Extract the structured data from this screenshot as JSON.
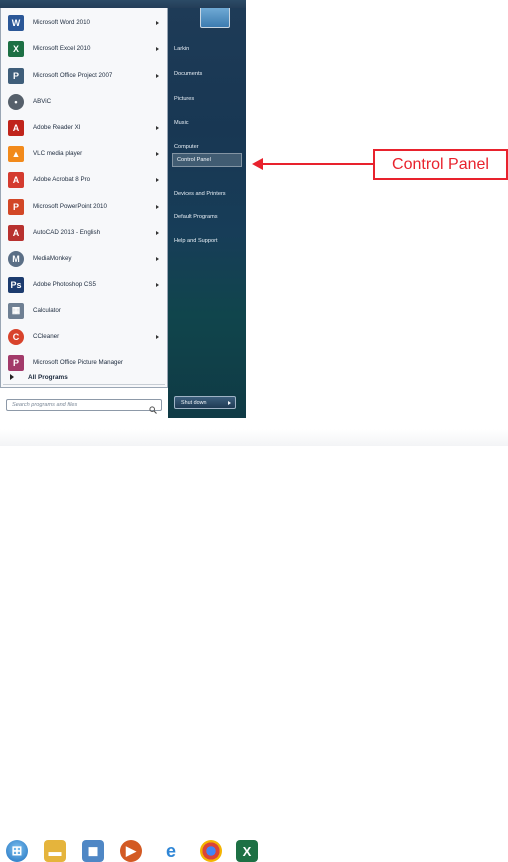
{
  "programs": [
    {
      "label": "Microsoft Word 2010",
      "icon": "word-icon",
      "arrow": true
    },
    {
      "label": "Microsoft Excel 2010",
      "icon": "excel-icon",
      "arrow": true
    },
    {
      "label": "Microsoft Office Project 2007",
      "icon": "project-icon",
      "arrow": true
    },
    {
      "label": "ABViC",
      "icon": "abvic-icon",
      "arrow": false
    },
    {
      "label": "Adobe Reader XI",
      "icon": "adobe-reader-icon",
      "arrow": true
    },
    {
      "label": "VLC media player",
      "icon": "vlc-icon",
      "arrow": true
    },
    {
      "label": "Adobe Acrobat 8 Pro",
      "icon": "acrobat-icon",
      "arrow": true
    },
    {
      "label": "Microsoft PowerPoint 2010",
      "icon": "powerpoint-icon",
      "arrow": true
    },
    {
      "label": "AutoCAD 2013 - English",
      "icon": "autocad-icon",
      "arrow": true
    },
    {
      "label": "MediaMonkey",
      "icon": "mediamonkey-icon",
      "arrow": true
    },
    {
      "label": "Adobe Photoshop CS5",
      "icon": "photoshop-icon",
      "arrow": true
    },
    {
      "label": "Calculator",
      "icon": "calculator-icon",
      "arrow": false
    },
    {
      "label": "CCleaner",
      "icon": "ccleaner-icon",
      "arrow": true
    },
    {
      "label": "Microsoft Office Picture Manager",
      "icon": "picture-manager-icon",
      "arrow": false
    }
  ],
  "all_programs_label": "All Programs",
  "search_placeholder": "Search programs and files",
  "right_items": [
    {
      "label": "Larkin"
    },
    {
      "label": "Documents"
    },
    {
      "label": "Pictures"
    },
    {
      "label": "Music"
    },
    {
      "label": "Computer"
    },
    {
      "label": "Control Panel",
      "highlighted": true
    },
    {
      "label": "Devices and Printers"
    },
    {
      "label": "Default Programs"
    },
    {
      "label": "Help and Support"
    }
  ],
  "shutdown_label": "Shut down",
  "callout_label": "Control Panel",
  "colors": {
    "accent_red": "#e8222d",
    "start_right_panel": "#1e3b57"
  },
  "taskbar_icons": [
    "start-orb-icon",
    "file-explorer-icon",
    "media-icon",
    "media-player-icon",
    "internet-explorer-icon",
    "chrome-icon",
    "excel-taskbar-icon"
  ]
}
